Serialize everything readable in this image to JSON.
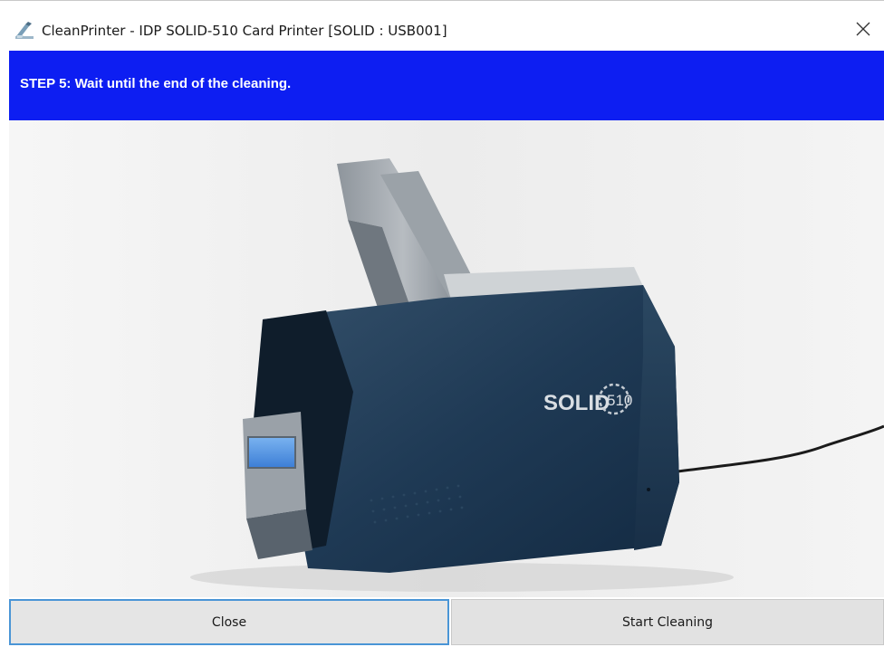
{
  "window": {
    "title": "CleanPrinter - IDP SOLID-510 Card Printer [SOLID : USB001]",
    "app_icon": "clean-printer-icon",
    "close_icon": "close-icon"
  },
  "banner": {
    "text": "STEP 5:  Wait until the end of the cleaning.",
    "color": "#0d1ef2"
  },
  "photo": {
    "brand_text": "SOLID",
    "model_text": "510"
  },
  "buttons": {
    "close_label": "Close",
    "start_label": "Start Cleaning"
  }
}
